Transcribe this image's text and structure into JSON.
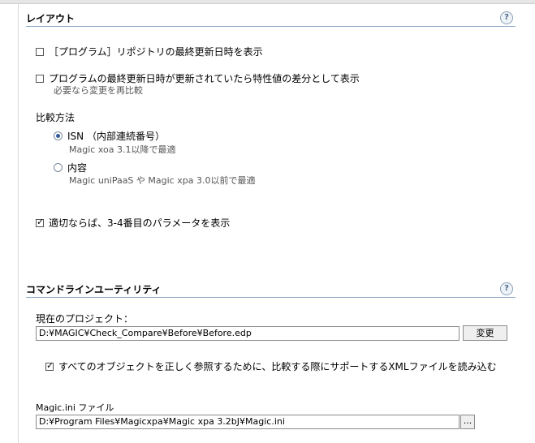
{
  "layout_section": {
    "title": "レイアウト",
    "help": "?",
    "show_repo_date": {
      "label": "［プログラム］リポジトリの最終更新日時を表示",
      "checked": false
    },
    "show_diff": {
      "label": "プログラムの最終更新日時が更新されていたら特性値の差分として表示",
      "hint": "必要なら変更を再比較",
      "checked": false
    },
    "compare_method": {
      "label": "比較方法",
      "options": [
        {
          "label": "ISN （内部連続番号）",
          "hint": "Magic xoa 3.1以降で最適",
          "selected": true
        },
        {
          "label": "内容",
          "hint": "Magic uniPaaS や Magic xpa 3.0以前で最適",
          "selected": false
        }
      ]
    },
    "show_params": {
      "label": "適切ならば、3-4番目のパラメータを表示",
      "checked": true
    }
  },
  "cmdline_section": {
    "title": "コマンドラインユーティリティ",
    "help": "?",
    "project_label": "現在のプロジェクト：",
    "project_path": "D:¥MAGIC¥Check_Compare¥Before¥Before.edp",
    "change_button": "変更",
    "load_xml": {
      "label": "すべてのオブジェクトを正しく参照するために、比較する際にサポートするXMLファイルを読み込む",
      "checked": true
    },
    "ini_label": "Magic.ini ファイル",
    "ini_path": "D:¥Program Files¥Magicxpa¥Magic xpa 3.2bJ¥Magic.ini",
    "browse_button": "..."
  }
}
